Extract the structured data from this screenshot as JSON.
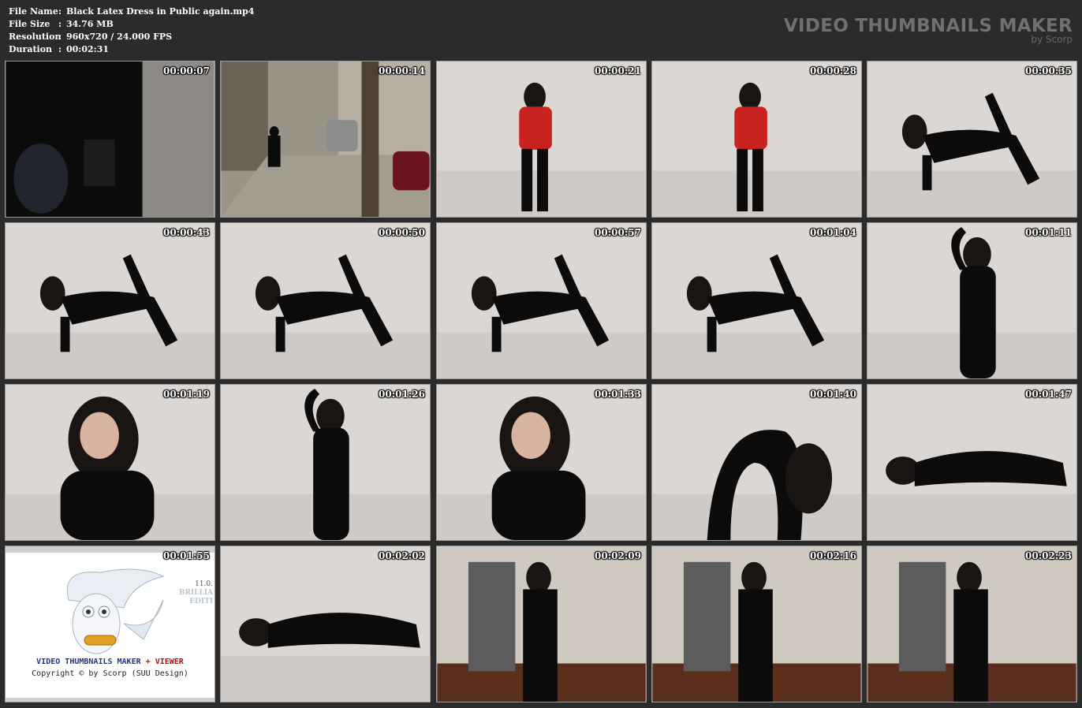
{
  "meta": {
    "rows": [
      {
        "label": "File Name",
        "value": "Black Latex Dress in Public again.mp4"
      },
      {
        "label": "File Size",
        "value": "34.76 MB"
      },
      {
        "label": "Resolution",
        "value": "960x720 / 24.000 FPS"
      },
      {
        "label": "Duration",
        "value": "00:02:31"
      }
    ],
    "separator": ":"
  },
  "brand": {
    "title": "VIDEO THUMBNAILS MAKER",
    "subtitle": "by Scorp"
  },
  "thumbnails": [
    {
      "time": "00:00:07"
    },
    {
      "time": "00:00:14"
    },
    {
      "time": "00:00:21"
    },
    {
      "time": "00:00:28"
    },
    {
      "time": "00:00:35"
    },
    {
      "time": "00:00:43"
    },
    {
      "time": "00:00:50"
    },
    {
      "time": "00:00:57"
    },
    {
      "time": "00:01:04"
    },
    {
      "time": "00:01:11"
    },
    {
      "time": "00:01:19"
    },
    {
      "time": "00:01:26"
    },
    {
      "time": "00:01:33"
    },
    {
      "time": "00:01:40"
    },
    {
      "time": "00:01:47"
    },
    {
      "time": "00:01:55"
    },
    {
      "time": "00:02:02"
    },
    {
      "time": "00:02:09"
    },
    {
      "time": "00:02:16"
    },
    {
      "time": "00:02:23"
    }
  ],
  "logo": {
    "version": "11.0.",
    "edition_1": "BRILLIA",
    "edition_2": "EDITI",
    "line1_a": "VIDEO THUMBNAILS MAKER",
    "line1_b": "+ VIEWER",
    "line2": "Copyright © by Scorp (SUU Design)"
  },
  "colors": {
    "background": "#2b2b2b",
    "wall": "#d9d4d0",
    "latex": "#0b0b0b",
    "red_top": "#c8231e"
  }
}
